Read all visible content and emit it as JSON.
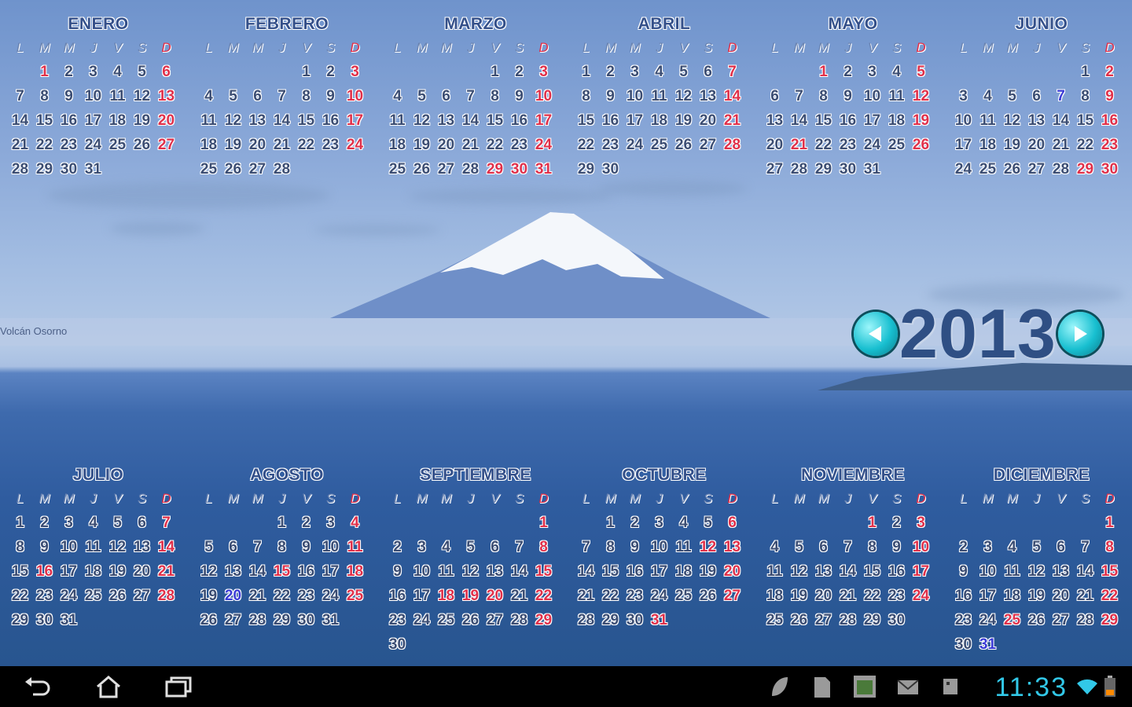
{
  "colors": {
    "sunday": "#e0304a",
    "today": "#3a3ad6",
    "text": "#3b4d73",
    "clock": "#32c8e8"
  },
  "weekday_labels": [
    "L",
    "M",
    "M",
    "J",
    "V",
    "S",
    "D"
  ],
  "year": {
    "value": "2013",
    "prev_icon": "left-arrow-icon",
    "next_icon": "right-arrow-icon"
  },
  "photo_caption": "Volcán Osorno",
  "months": [
    {
      "name": "ENERO",
      "offset": 1,
      "days": 31,
      "holidays": [
        1
      ]
    },
    {
      "name": "FEBRERO",
      "offset": 4,
      "days": 28,
      "holidays": []
    },
    {
      "name": "MARZO",
      "offset": 4,
      "days": 31,
      "holidays": [
        29,
        30
      ]
    },
    {
      "name": "ABRIL",
      "offset": 0,
      "days": 30,
      "holidays": []
    },
    {
      "name": "MAYO",
      "offset": 2,
      "days": 31,
      "holidays": [
        1,
        21
      ]
    },
    {
      "name": "JUNIO",
      "offset": 5,
      "days": 30,
      "holidays": [
        29
      ],
      "today": [
        7
      ]
    },
    {
      "name": "JULIO",
      "offset": 0,
      "days": 31,
      "holidays": [
        16
      ]
    },
    {
      "name": "AGOSTO",
      "offset": 3,
      "days": 31,
      "holidays": [
        15
      ],
      "today": [
        20
      ]
    },
    {
      "name": "SEPTIEMBRE",
      "offset": 6,
      "days": 30,
      "holidays": [
        18,
        19,
        20
      ]
    },
    {
      "name": "OCTUBRE",
      "offset": 1,
      "days": 31,
      "holidays": [
        12,
        31
      ]
    },
    {
      "name": "NOVIEMBRE",
      "offset": 4,
      "days": 30,
      "holidays": [
        1
      ]
    },
    {
      "name": "DICIEMBRE",
      "offset": 6,
      "days": 31,
      "holidays": [
        25
      ],
      "today": [
        31
      ]
    }
  ],
  "status_bar": {
    "time": "11:33",
    "nav_icons": [
      "back-icon",
      "home-icon",
      "recent-apps-icon"
    ],
    "notification_icons": [
      "leaf-notification-icon",
      "sd-card-icon",
      "gallery-notification-icon",
      "email-icon",
      "calendar-notification-icon"
    ],
    "status_icons": [
      "wifi-icon",
      "battery-icon"
    ]
  }
}
